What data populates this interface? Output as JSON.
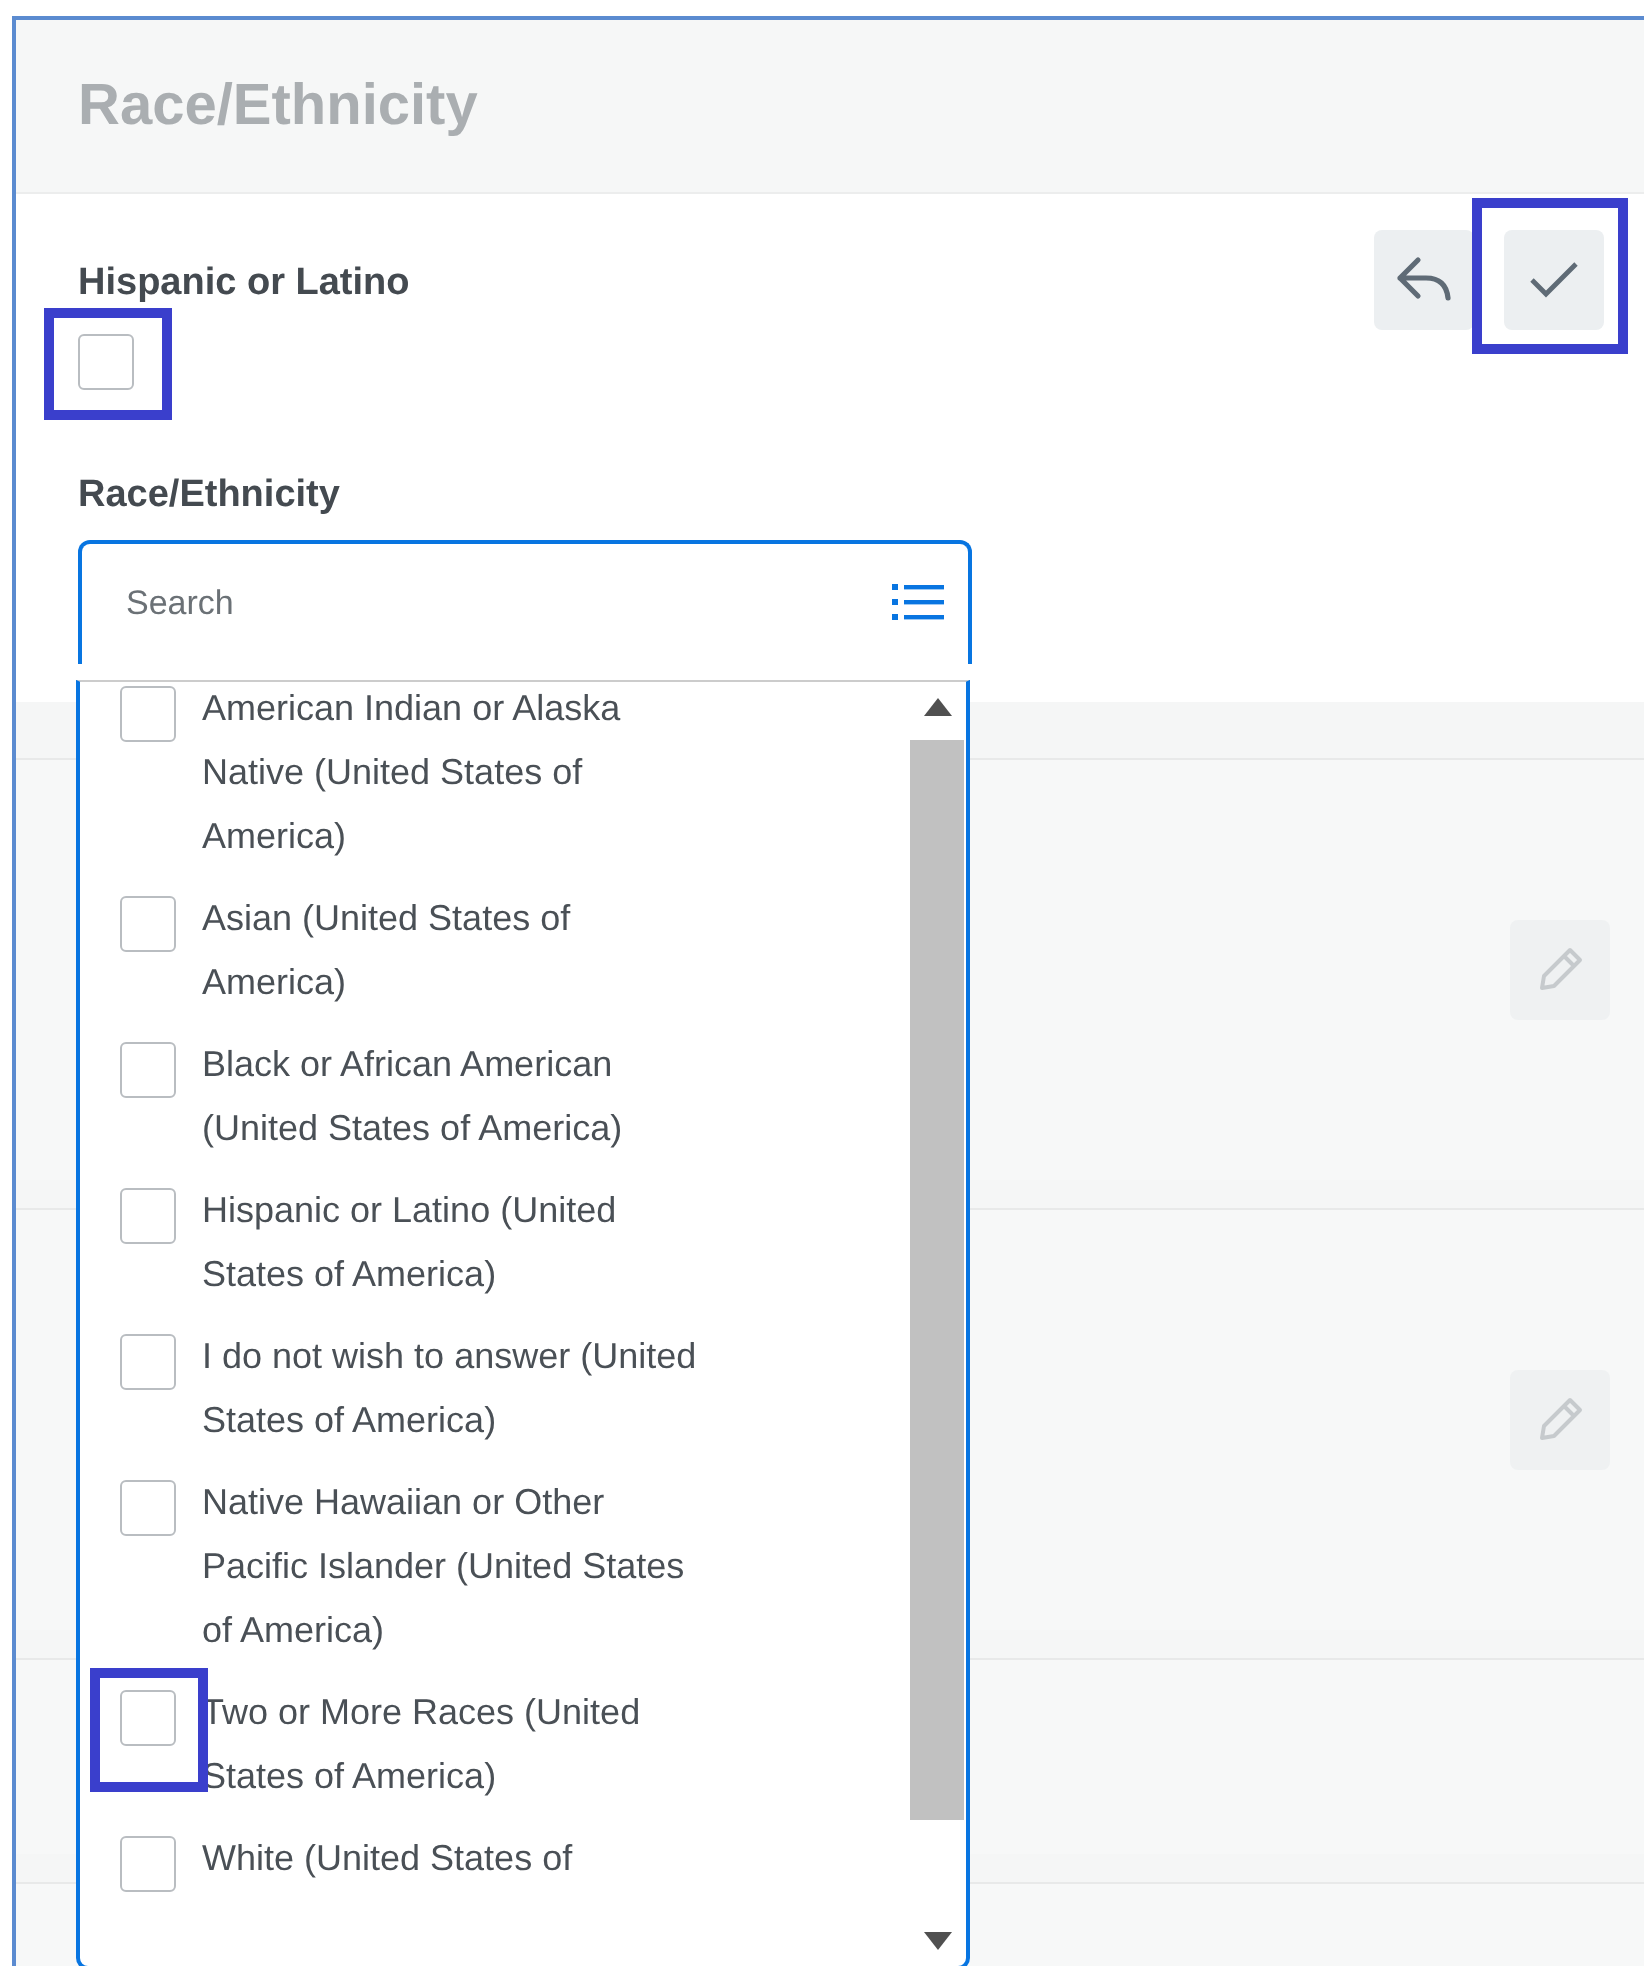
{
  "header": {
    "title": "Race/Ethnicity"
  },
  "actions": [
    {
      "kind": "cancel"
    },
    {
      "kind": "confirm",
      "highlighted": true
    }
  ],
  "hispanic": {
    "label": "Hispanic or Latino",
    "checked": false,
    "highlighted": true
  },
  "race": {
    "label": "Race/Ethnicity",
    "placeholder": "Search",
    "options": [
      {
        "label": "American Indian or Alaska Native (United States of America)",
        "checked": false,
        "highlighted": false
      },
      {
        "label": "Asian (United States of America)",
        "checked": false,
        "highlighted": false
      },
      {
        "label": "Black or African American (United States of America)",
        "checked": false,
        "highlighted": false
      },
      {
        "label": "Hispanic or Latino (United States of America)",
        "checked": false,
        "highlighted": false
      },
      {
        "label": "I do not wish to answer (United States of America)",
        "checked": false,
        "highlighted": false
      },
      {
        "label": "Native Hawaiian or Other Pacific Islander (United States of America)",
        "checked": false,
        "highlighted": false
      },
      {
        "label": "Two or More Races (United States of America)",
        "checked": false,
        "highlighted": true
      },
      {
        "label": "White (United States of",
        "checked": false,
        "highlighted": false
      }
    ]
  },
  "cards": [
    {
      "editable": true
    },
    {
      "editable": true
    },
    {
      "editable": false
    },
    {
      "editable": false
    }
  ]
}
